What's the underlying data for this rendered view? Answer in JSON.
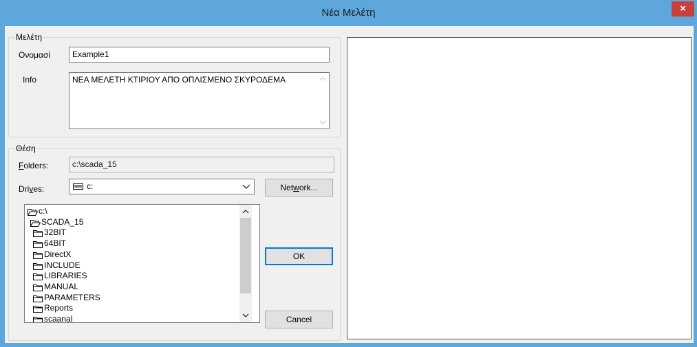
{
  "window": {
    "title": "Νέα Μελέτη",
    "close_glyph": "×"
  },
  "study_group": {
    "legend": "Μελέτη",
    "name_label": "Ονομασί",
    "name_value": "Example1",
    "info_label": "Info",
    "info_value": "ΝΕΑ ΜΕΛΕΤΗ ΚΤΙΡΙΟΥ ΑΠΟ ΟΠΛΙΣΜΕΝΟ ΣΚΥΡΟΔΕΜΑ"
  },
  "location_group": {
    "legend": "Θέση",
    "folders_label_first": "F",
    "folders_label_rest": "olders:",
    "folders_value": "c:\\scada_15",
    "drives_label_first": "Dri",
    "drives_label_u": "v",
    "drives_label_rest": "es:",
    "drive_value": "c:",
    "network_pre": "Net",
    "network_u": "w",
    "network_post": "ork..."
  },
  "folders": [
    {
      "label": "c:\\",
      "icon": "open-folder-icon",
      "indent": 0
    },
    {
      "label": "SCADA_15",
      "icon": "open-folder-icon",
      "indent": 1
    },
    {
      "label": "32BIT",
      "icon": "folder-icon",
      "indent": 2
    },
    {
      "label": "64BIT",
      "icon": "folder-icon",
      "indent": 2
    },
    {
      "label": "DirectX",
      "icon": "folder-icon",
      "indent": 2
    },
    {
      "label": "INCLUDE",
      "icon": "folder-icon",
      "indent": 2
    },
    {
      "label": "LIBRARIES",
      "icon": "folder-icon",
      "indent": 2
    },
    {
      "label": "MANUAL",
      "icon": "folder-icon",
      "indent": 2
    },
    {
      "label": "PARAMETERS",
      "icon": "folder-icon",
      "indent": 2
    },
    {
      "label": "Reports",
      "icon": "folder-icon",
      "indent": 2
    },
    {
      "label": "scaanal",
      "icon": "folder-icon",
      "indent": 2
    }
  ],
  "buttons": {
    "ok": "OK",
    "cancel": "Cancel"
  },
  "colors": {
    "title_bar": "#5ea7dd",
    "close_button": "#c7413b",
    "dialog_bg": "#f0f0f0",
    "default_button_border": "#0078d7"
  }
}
